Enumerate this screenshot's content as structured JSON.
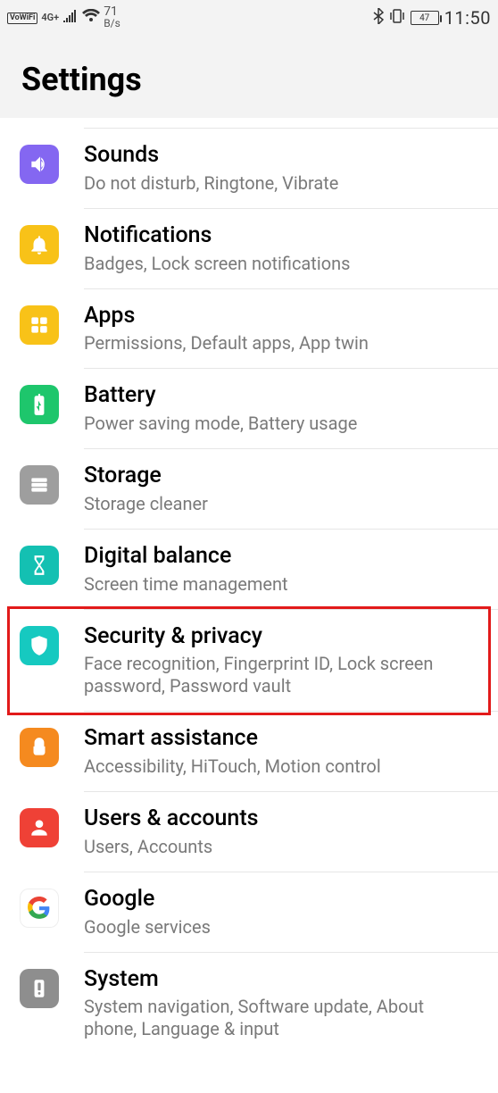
{
  "status": {
    "vowifi": "VoWiFi",
    "net": "4G+",
    "speed_value": "71",
    "speed_unit": "B/s",
    "battery": "47",
    "clock": "11:50"
  },
  "header": {
    "title": "Settings"
  },
  "rows": [
    {
      "title": "Sounds",
      "sub": "Do not disturb, Ringtone, Vibrate"
    },
    {
      "title": "Notifications",
      "sub": "Badges, Lock screen notifications"
    },
    {
      "title": "Apps",
      "sub": "Permissions, Default apps, App twin"
    },
    {
      "title": "Battery",
      "sub": "Power saving mode, Battery usage"
    },
    {
      "title": "Storage",
      "sub": "Storage cleaner"
    },
    {
      "title": "Digital balance",
      "sub": "Screen time management"
    },
    {
      "title": "Security & privacy",
      "sub": "Face recognition, Fingerprint ID, Lock screen password, Password vault"
    },
    {
      "title": "Smart assistance",
      "sub": "Accessibility, HiTouch, Motion control"
    },
    {
      "title": "Users & accounts",
      "sub": "Users, Accounts"
    },
    {
      "title": "Google",
      "sub": "Google services"
    },
    {
      "title": "System",
      "sub": "System navigation, Software update, About phone, Language & input"
    }
  ],
  "highlight_index": 6
}
